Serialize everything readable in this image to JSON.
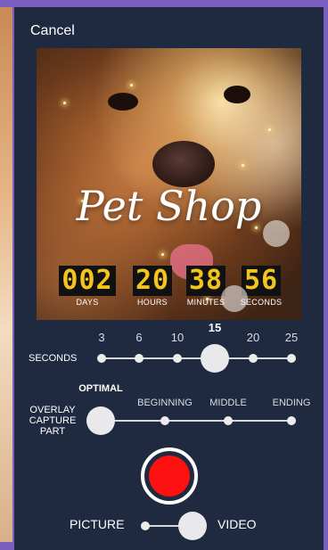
{
  "header": {
    "cancel_label": "Cancel"
  },
  "preview": {
    "title": "Pet Shop",
    "countdown": [
      {
        "value": "002",
        "label": "DAYS"
      },
      {
        "value": "20",
        "label": "HOURS"
      },
      {
        "value": "38",
        "label": "MINUTES"
      },
      {
        "value": "56",
        "label": "SECONDS"
      }
    ]
  },
  "seconds_slider": {
    "label": "SECONDS",
    "options": [
      "3",
      "6",
      "10",
      "15",
      "20",
      "25"
    ],
    "selected": "15"
  },
  "overlay_capture": {
    "label": "OVERLAY CAPTURE PART",
    "options": [
      "OPTIMAL",
      "BEGINNING",
      "MIDDLE",
      "ENDING"
    ],
    "selected": "OPTIMAL"
  },
  "mode_toggle": {
    "left_label": "PICTURE",
    "right_label": "VIDEO",
    "selected": "VIDEO"
  },
  "colors": {
    "record": "#ff1010",
    "panel": "#1f2a40",
    "frame": "#7a5fc0",
    "digits": "#f2c41d"
  },
  "icons": {
    "record_button": "record-circle-icon"
  }
}
